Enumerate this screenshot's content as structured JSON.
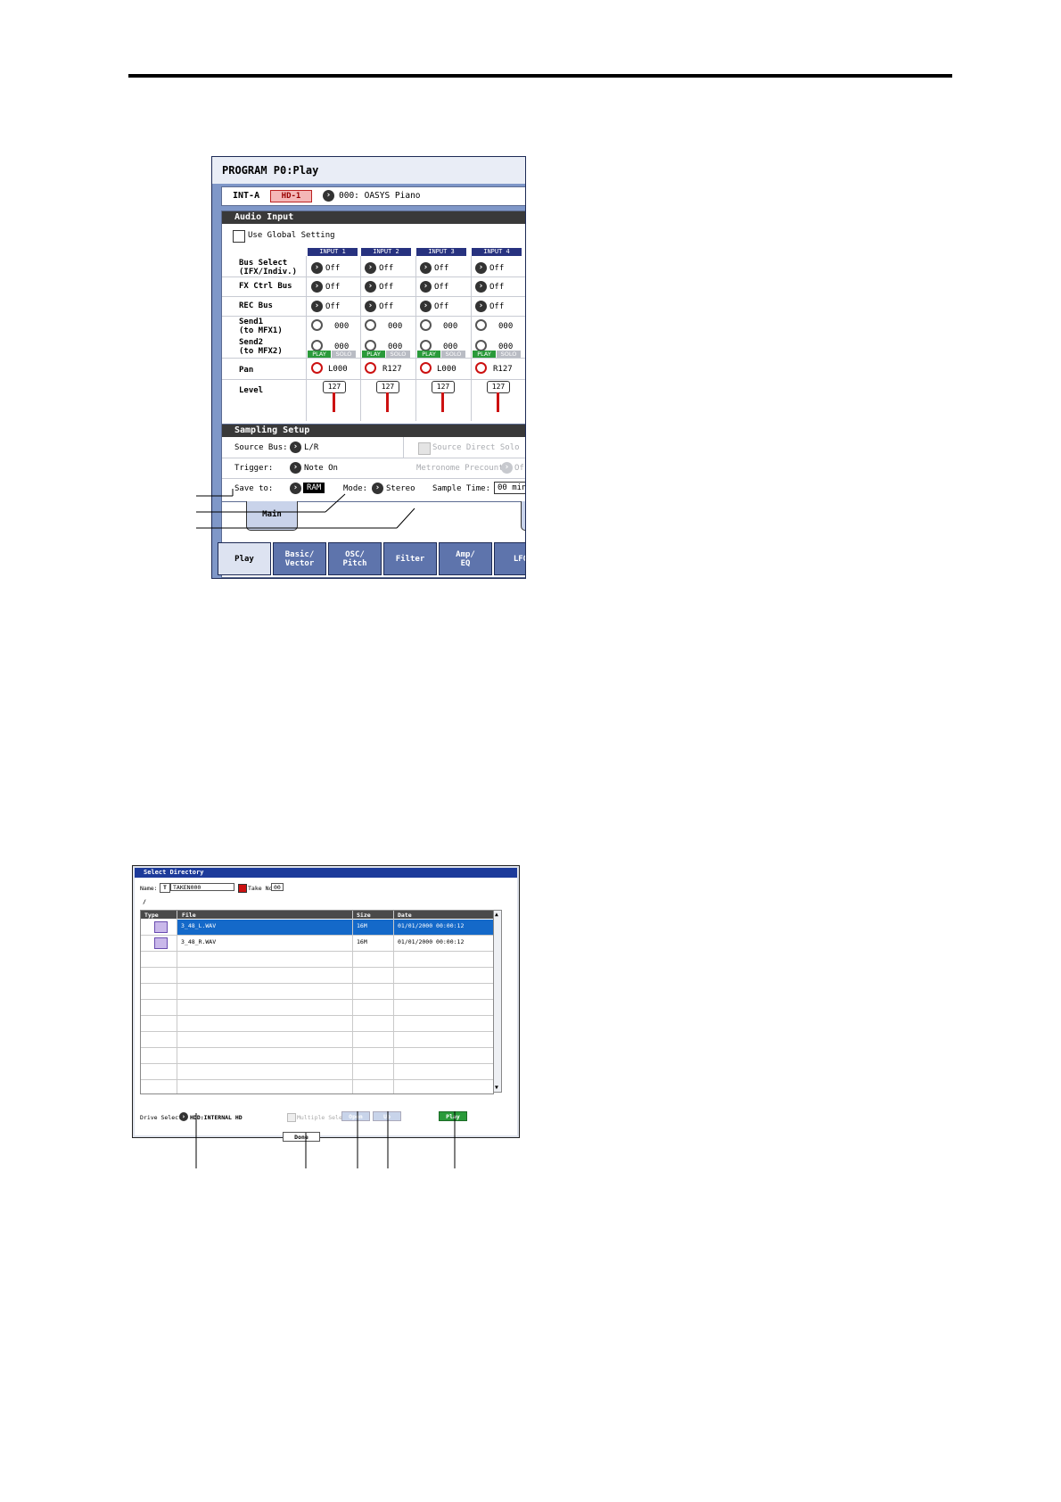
{
  "program": {
    "title": "PROGRAM P0:Play",
    "bank": "INT-A",
    "hd_label": "HD-1",
    "program_name": "000: OASYS Piano"
  },
  "audio_input": {
    "header": "Audio Input",
    "use_global": "Use Global Setting",
    "columns": [
      "INPUT 1",
      "INPUT 2",
      "INPUT 3",
      "INPUT 4"
    ],
    "rows": {
      "bus_select": "Bus Select\n(IFX/Indiv.)",
      "fx_ctrl_bus": "FX Ctrl Bus",
      "rec_bus": "REC Bus",
      "send1": "Send1\n(to MFX1)",
      "send2": "Send2\n(to MFX2)",
      "pan": "Pan",
      "level": "Level"
    },
    "bus_select_values": [
      "Off",
      "Off",
      "Off",
      "Off"
    ],
    "fx_ctrl_values": [
      "Off",
      "Off",
      "Off",
      "Off"
    ],
    "rec_bus_values": [
      "Off",
      "Off",
      "Off",
      "Off"
    ],
    "send1_values": [
      "000",
      "000",
      "000",
      "000"
    ],
    "send2_values": [
      "000",
      "000",
      "000",
      "000"
    ],
    "play_label": "PLAY",
    "solo_label": "SOLO",
    "pan_values": [
      "L000",
      "R127",
      "L000",
      "R127"
    ],
    "level_values": [
      "127",
      "127",
      "127",
      "127"
    ]
  },
  "sampling_setup": {
    "header": "Sampling Setup",
    "source_bus_label": "Source Bus:",
    "source_bus_value": "L/R",
    "source_direct_solo": "Source Direct Solo",
    "trigger_label": "Trigger:",
    "trigger_value": "Note On",
    "metronome_label": "Metronome Precount:",
    "metronome_value": "Of",
    "save_to_label": "Save to:",
    "save_to_value": "RAM",
    "mode_label": "Mode:",
    "mode_value": "Stereo",
    "sample_time_label": "Sample Time:",
    "sample_time_value": "00 min"
  },
  "sub_tabs": {
    "main": "Main"
  },
  "page_tabs": [
    "Play",
    "Basic/\nVector",
    "OSC/\nPitch",
    "Filter",
    "Amp/\nEQ",
    "LFO"
  ],
  "select_directory": {
    "title": "Select Directory",
    "name_label": "Name:",
    "name_value": "TAKEN000",
    "take_no_label": "Take No.",
    "take_no_value": "00",
    "path": "/",
    "columns": [
      "Type",
      "File",
      "Size",
      "Date"
    ],
    "files": [
      {
        "name": "3_48_L.WAV",
        "size": "16M",
        "date": "01/01/2000 00:00:12"
      },
      {
        "name": "3_48_R.WAV",
        "size": "16M",
        "date": "01/01/2000 00:00:12"
      }
    ],
    "drive_select_label": "Drive Select",
    "drive_select_value": "HDD:INTERNAL HD",
    "multiple_select": "Multiple Select",
    "open": "Open",
    "up": "Up",
    "play": "Play",
    "done": "Done"
  },
  "colors": {
    "tab_blue": "#5e74ac",
    "header_dark": "#393939",
    "play_green": "#2a9a3a",
    "select_blue": "#1469c9",
    "title_blue": "#1c3a9a"
  }
}
